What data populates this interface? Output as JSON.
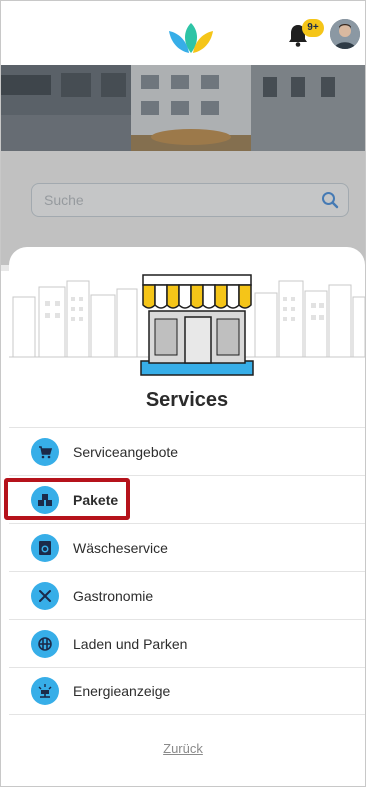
{
  "header": {
    "notification_badge": "9+"
  },
  "search": {
    "placeholder": "Suche"
  },
  "sheet": {
    "title": "Services",
    "items": [
      {
        "label": "Serviceangebote",
        "icon": "cart-icon"
      },
      {
        "label": "Pakete",
        "icon": "package-icon"
      },
      {
        "label": "Wäscheservice",
        "icon": "washing-machine-icon"
      },
      {
        "label": "Gastronomie",
        "icon": "cutlery-icon"
      },
      {
        "label": "Laden und Parken",
        "icon": "charging-icon"
      },
      {
        "label": "Energieanzeige",
        "icon": "energy-icon"
      }
    ],
    "back_label": "Zurück"
  },
  "colors": {
    "accent": "#37aee8",
    "badge": "#f5c518",
    "highlight": "#b5121b",
    "awning_yellow": "#f5c518",
    "awning_blue": "#37aee8"
  }
}
